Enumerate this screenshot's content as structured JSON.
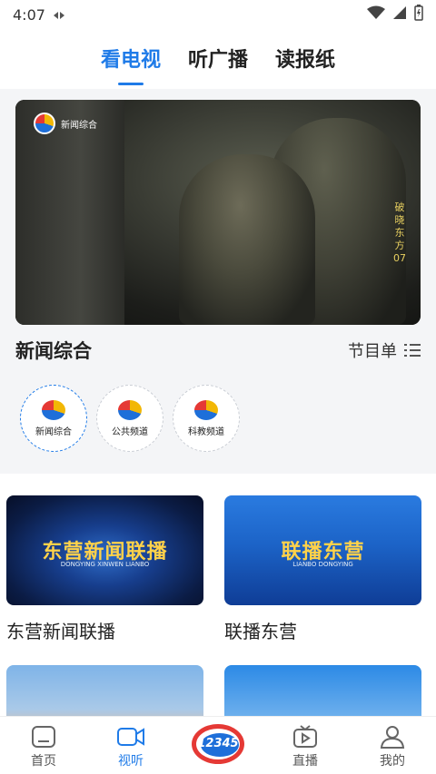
{
  "status_bar": {
    "time": "4:07"
  },
  "tabs": [
    {
      "label": "看电视",
      "active": true
    },
    {
      "label": "听广播",
      "active": false
    },
    {
      "label": "读报纸",
      "active": false
    }
  ],
  "player": {
    "channel_logo_text": "新闻综合",
    "drama_title": "破晓东方07"
  },
  "program": {
    "title": "新闻综合",
    "schedule_label": "节目单"
  },
  "channels": [
    {
      "name": "新闻综合",
      "active": true
    },
    {
      "name": "公共频道",
      "active": false
    },
    {
      "name": "科教频道",
      "active": false
    }
  ],
  "cards": [
    {
      "title": "东营新闻联播",
      "thumb_text": "东营新闻联播",
      "thumb_sub": "DONGYING XINWEN LIANBO"
    },
    {
      "title": "联播东营",
      "thumb_text": "联播东营",
      "thumb_sub": "LIANBO DONGYING"
    },
    {
      "title": "",
      "thumb_text": "",
      "thumb_sub": ""
    },
    {
      "title": "",
      "thumb_text": "",
      "thumb_sub": ""
    }
  ],
  "bottom_nav": [
    {
      "label": "首页",
      "active": false,
      "icon": "home-icon"
    },
    {
      "label": "视听",
      "active": true,
      "icon": "video-camera-icon"
    },
    {
      "label": "",
      "active": false,
      "icon": "hotline-12345-icon",
      "badge_text": "12345"
    },
    {
      "label": "直播",
      "active": false,
      "icon": "tv-live-icon"
    },
    {
      "label": "我的",
      "active": false,
      "icon": "profile-icon"
    }
  ],
  "colors": {
    "accent": "#1f7be8",
    "section_bg": "#f4f5f7",
    "hotline_red": "#e53935"
  }
}
